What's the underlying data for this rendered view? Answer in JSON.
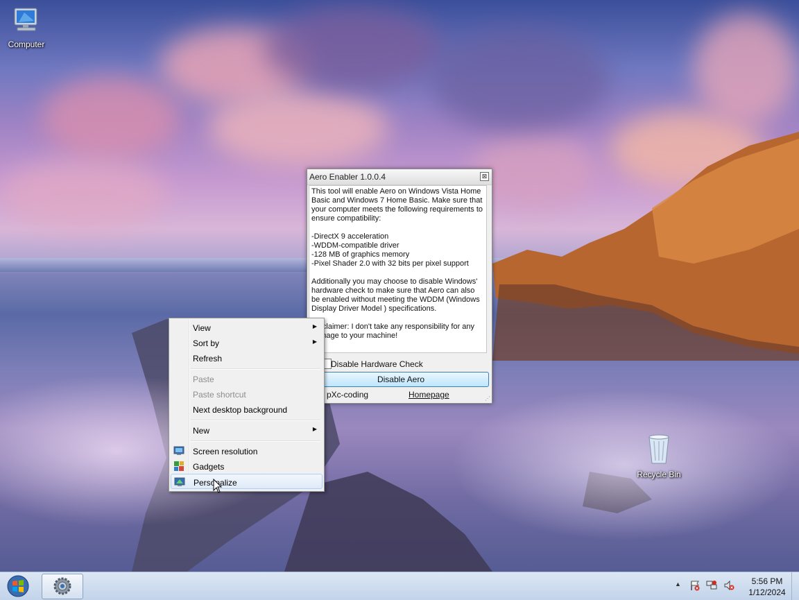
{
  "desktop": {
    "icons": [
      {
        "label": "Computer"
      },
      {
        "label": "Recycle Bin"
      }
    ]
  },
  "aero_window": {
    "title": "Aero Enabler 1.0.0.4",
    "close_glyph": "⊠",
    "description": "This tool will enable Aero on Windows Vista Home Basic and Windows 7 Home Basic. Make sure that your computer meets the following requirements to ensure compatibility:\n\n-DirectX 9 acceleration\n-WDDM-compatible driver\n-128 MB of graphics memory\n-Pixel Shader 2.0 with 32 bits per pixel support\n\nAdditionally you may choose to disable Windows' hardware check to make sure that Aero can also be enabled without meeting the WDDM (Windows Display Driver Model ) specifications.\n\nDisclaimer: I don't take any responsibility for any damage to your machine!",
    "checkbox_label": "Disable Hardware Check",
    "checkbox_checked": false,
    "button_label": "Disable Aero",
    "credit": "by pXc-coding",
    "homepage_link": "Homepage"
  },
  "context_menu": {
    "items": [
      {
        "label": "View",
        "submenu": true,
        "disabled": false
      },
      {
        "label": "Sort by",
        "submenu": true,
        "disabled": false
      },
      {
        "label": "Refresh",
        "submenu": false,
        "disabled": false
      },
      {
        "label": "Paste",
        "submenu": false,
        "disabled": true
      },
      {
        "label": "Paste shortcut",
        "submenu": false,
        "disabled": true
      },
      {
        "label": "Next desktop background",
        "submenu": false,
        "disabled": false
      },
      {
        "label": "New",
        "submenu": true,
        "disabled": false
      },
      {
        "label": "Screen resolution",
        "icon": "display-icon"
      },
      {
        "label": "Gadgets",
        "icon": "gadgets-icon"
      },
      {
        "label": "Personalize",
        "icon": "personalize-icon",
        "highlighted": true
      }
    ],
    "submenu_arrow": "▶"
  },
  "taskbar": {
    "tray_expand_glyph": "▲",
    "time": "5:56 PM",
    "date": "1/12/2024",
    "tray_icons": [
      "action-center-flag-icon",
      "network-icon",
      "volume-muted-icon"
    ]
  },
  "colors": {
    "taskbar_top": "#dce7f4",
    "taskbar_bottom": "#c2d3ea",
    "menu_highlight_border": "#aecff7",
    "button_border": "#3c7fb1"
  }
}
